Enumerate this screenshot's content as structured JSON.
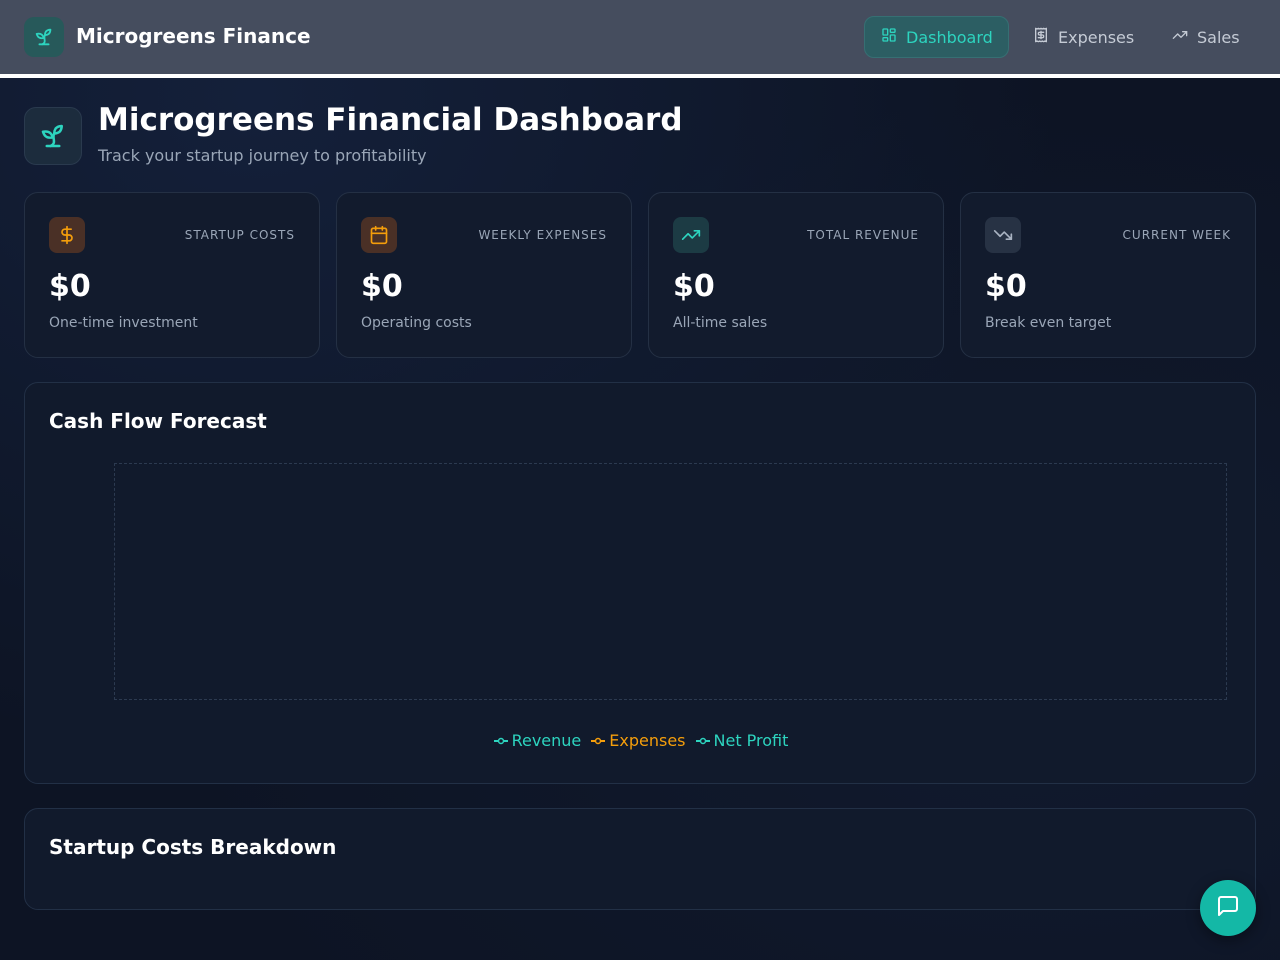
{
  "app": {
    "title": "Microgreens Finance"
  },
  "nav": {
    "items": [
      {
        "label": "Dashboard",
        "icon": "dashboard-grid-icon",
        "active": true
      },
      {
        "label": "Expenses",
        "icon": "receipt-icon",
        "active": false
      },
      {
        "label": "Sales",
        "icon": "trending-up-icon",
        "active": false
      }
    ]
  },
  "header": {
    "title": "Microgreens Financial Dashboard",
    "subtitle": "Track your startup journey to profitability"
  },
  "cards": [
    {
      "label": "STARTUP COSTS",
      "value": "$0",
      "description": "One-time investment",
      "icon": "dollar-icon",
      "accent": "#f59e0b"
    },
    {
      "label": "WEEKLY EXPENSES",
      "value": "$0",
      "description": "Operating costs",
      "icon": "calendar-icon",
      "accent": "#f59e0b"
    },
    {
      "label": "TOTAL REVENUE",
      "value": "$0",
      "description": "All-time sales",
      "icon": "trending-up-icon",
      "accent": "#2dd4bf"
    },
    {
      "label": "CURRENT WEEK",
      "value": "$0",
      "description": "Break even target",
      "icon": "trending-down-icon",
      "accent": "#9aa6b7"
    }
  ],
  "cashflow": {
    "title": "Cash Flow Forecast",
    "legend": [
      {
        "label": "Revenue",
        "color": "#2dd4bf"
      },
      {
        "label": "Expenses",
        "color": "#f59e0b"
      },
      {
        "label": "Net Profit",
        "color": "#2dd4bf"
      }
    ]
  },
  "breakdown": {
    "title": "Startup Costs Breakdown"
  },
  "colors": {
    "accent": "#14b8a6",
    "background": "#0d1424",
    "nav": "#454d5e"
  }
}
